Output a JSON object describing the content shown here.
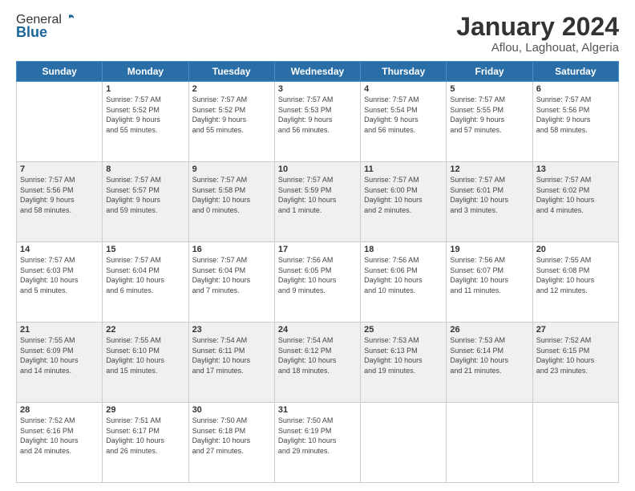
{
  "header": {
    "logo_general": "General",
    "logo_blue": "Blue",
    "title": "January 2024",
    "subtitle": "Aflou, Laghouat, Algeria"
  },
  "days_of_week": [
    "Sunday",
    "Monday",
    "Tuesday",
    "Wednesday",
    "Thursday",
    "Friday",
    "Saturday"
  ],
  "weeks": [
    [
      {
        "day": "",
        "info": ""
      },
      {
        "day": "1",
        "info": "Sunrise: 7:57 AM\nSunset: 5:52 PM\nDaylight: 9 hours\nand 55 minutes."
      },
      {
        "day": "2",
        "info": "Sunrise: 7:57 AM\nSunset: 5:52 PM\nDaylight: 9 hours\nand 55 minutes."
      },
      {
        "day": "3",
        "info": "Sunrise: 7:57 AM\nSunset: 5:53 PM\nDaylight: 9 hours\nand 56 minutes."
      },
      {
        "day": "4",
        "info": "Sunrise: 7:57 AM\nSunset: 5:54 PM\nDaylight: 9 hours\nand 56 minutes."
      },
      {
        "day": "5",
        "info": "Sunrise: 7:57 AM\nSunset: 5:55 PM\nDaylight: 9 hours\nand 57 minutes."
      },
      {
        "day": "6",
        "info": "Sunrise: 7:57 AM\nSunset: 5:56 PM\nDaylight: 9 hours\nand 58 minutes."
      }
    ],
    [
      {
        "day": "7",
        "info": "Sunrise: 7:57 AM\nSunset: 5:56 PM\nDaylight: 9 hours\nand 58 minutes."
      },
      {
        "day": "8",
        "info": "Sunrise: 7:57 AM\nSunset: 5:57 PM\nDaylight: 9 hours\nand 59 minutes."
      },
      {
        "day": "9",
        "info": "Sunrise: 7:57 AM\nSunset: 5:58 PM\nDaylight: 10 hours\nand 0 minutes."
      },
      {
        "day": "10",
        "info": "Sunrise: 7:57 AM\nSunset: 5:59 PM\nDaylight: 10 hours\nand 1 minute."
      },
      {
        "day": "11",
        "info": "Sunrise: 7:57 AM\nSunset: 6:00 PM\nDaylight: 10 hours\nand 2 minutes."
      },
      {
        "day": "12",
        "info": "Sunrise: 7:57 AM\nSunset: 6:01 PM\nDaylight: 10 hours\nand 3 minutes."
      },
      {
        "day": "13",
        "info": "Sunrise: 7:57 AM\nSunset: 6:02 PM\nDaylight: 10 hours\nand 4 minutes."
      }
    ],
    [
      {
        "day": "14",
        "info": "Sunrise: 7:57 AM\nSunset: 6:03 PM\nDaylight: 10 hours\nand 5 minutes."
      },
      {
        "day": "15",
        "info": "Sunrise: 7:57 AM\nSunset: 6:04 PM\nDaylight: 10 hours\nand 6 minutes."
      },
      {
        "day": "16",
        "info": "Sunrise: 7:57 AM\nSunset: 6:04 PM\nDaylight: 10 hours\nand 7 minutes."
      },
      {
        "day": "17",
        "info": "Sunrise: 7:56 AM\nSunset: 6:05 PM\nDaylight: 10 hours\nand 9 minutes."
      },
      {
        "day": "18",
        "info": "Sunrise: 7:56 AM\nSunset: 6:06 PM\nDaylight: 10 hours\nand 10 minutes."
      },
      {
        "day": "19",
        "info": "Sunrise: 7:56 AM\nSunset: 6:07 PM\nDaylight: 10 hours\nand 11 minutes."
      },
      {
        "day": "20",
        "info": "Sunrise: 7:55 AM\nSunset: 6:08 PM\nDaylight: 10 hours\nand 12 minutes."
      }
    ],
    [
      {
        "day": "21",
        "info": "Sunrise: 7:55 AM\nSunset: 6:09 PM\nDaylight: 10 hours\nand 14 minutes."
      },
      {
        "day": "22",
        "info": "Sunrise: 7:55 AM\nSunset: 6:10 PM\nDaylight: 10 hours\nand 15 minutes."
      },
      {
        "day": "23",
        "info": "Sunrise: 7:54 AM\nSunset: 6:11 PM\nDaylight: 10 hours\nand 17 minutes."
      },
      {
        "day": "24",
        "info": "Sunrise: 7:54 AM\nSunset: 6:12 PM\nDaylight: 10 hours\nand 18 minutes."
      },
      {
        "day": "25",
        "info": "Sunrise: 7:53 AM\nSunset: 6:13 PM\nDaylight: 10 hours\nand 19 minutes."
      },
      {
        "day": "26",
        "info": "Sunrise: 7:53 AM\nSunset: 6:14 PM\nDaylight: 10 hours\nand 21 minutes."
      },
      {
        "day": "27",
        "info": "Sunrise: 7:52 AM\nSunset: 6:15 PM\nDaylight: 10 hours\nand 23 minutes."
      }
    ],
    [
      {
        "day": "28",
        "info": "Sunrise: 7:52 AM\nSunset: 6:16 PM\nDaylight: 10 hours\nand 24 minutes."
      },
      {
        "day": "29",
        "info": "Sunrise: 7:51 AM\nSunset: 6:17 PM\nDaylight: 10 hours\nand 26 minutes."
      },
      {
        "day": "30",
        "info": "Sunrise: 7:50 AM\nSunset: 6:18 PM\nDaylight: 10 hours\nand 27 minutes."
      },
      {
        "day": "31",
        "info": "Sunrise: 7:50 AM\nSunset: 6:19 PM\nDaylight: 10 hours\nand 29 minutes."
      },
      {
        "day": "",
        "info": ""
      },
      {
        "day": "",
        "info": ""
      },
      {
        "day": "",
        "info": ""
      }
    ]
  ]
}
